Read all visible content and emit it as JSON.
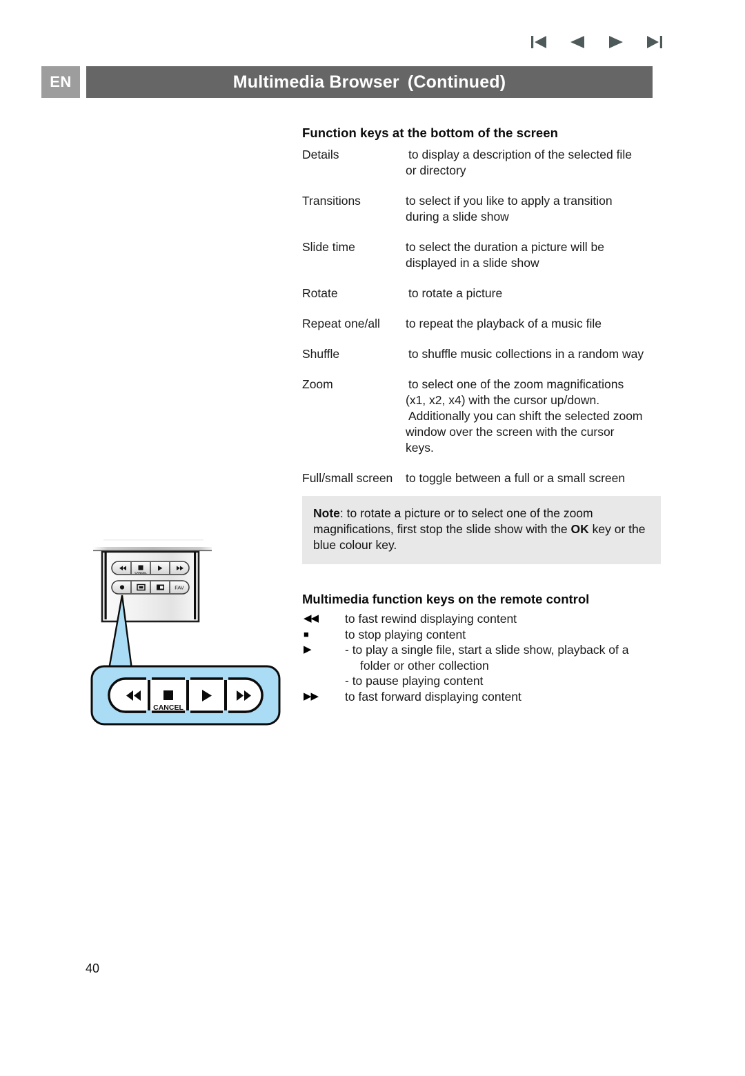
{
  "nav": {
    "icons": [
      {
        "name": "first-page-icon",
        "label": "first"
      },
      {
        "name": "previous-page-icon",
        "label": "previous"
      },
      {
        "name": "next-page-icon",
        "label": "next"
      },
      {
        "name": "last-page-icon",
        "label": "last"
      }
    ],
    "color": "#4e5a5a"
  },
  "header": {
    "language": "EN",
    "title": "Multimedia Browser",
    "title_suffix": "(Continued)",
    "bar_color": "#666666",
    "badge_color": "#9d9d9d"
  },
  "function_keys": {
    "heading": "Function keys at the bottom of the screen",
    "rows": [
      {
        "term": "Details",
        "lines": [
          "to display a description of the selected file",
          "or directory"
        ]
      },
      {
        "term": "Transitions",
        "lines": [
          "to select if you like to apply a transition",
          "during a slide show"
        ]
      },
      {
        "term": "Slide time",
        "lines": [
          "to select the duration a picture will be",
          "displayed in a slide show"
        ]
      },
      {
        "term": "Rotate",
        "lines": [
          "to rotate a picture"
        ]
      },
      {
        "term": "Repeat one/all",
        "lines": [
          "to repeat the playback of a music file"
        ]
      },
      {
        "term": "Shuffle",
        "lines": [
          "to shuffle music collections in a random way"
        ]
      },
      {
        "term": "Zoom",
        "lines": [
          "to select one of the zoom magnifications",
          "(x1, x2, x4) with the cursor up/down.",
          "Additionally you can shift the selected zoom",
          "window over the screen with the cursor",
          "keys."
        ]
      },
      {
        "term": "Full/small screen",
        "lines": [
          "to toggle between a full or a small screen"
        ]
      }
    ]
  },
  "note": {
    "label": "Note",
    "part1": ": to rotate a picture or to select one of the zoom magnifications, first stop the slide show with the ",
    "emphasis": "OK",
    "part2": " key or the blue colour key.",
    "background": "#e8e8e8"
  },
  "remote_keys": {
    "heading": "Multimedia function keys on the remote control",
    "rows": [
      {
        "glyph": "◀◀",
        "icon": "rewind-icon",
        "lines": [
          "to fast rewind displaying content"
        ]
      },
      {
        "glyph": "■",
        "icon": "stop-icon",
        "lines": [
          "to stop playing content"
        ]
      },
      {
        "glyph": "▶",
        "icon": "play-pause-icon",
        "lines": [
          "- to play a single file, start a slide show, playback of a",
          "folder or other collection",
          "- to pause playing content"
        ]
      },
      {
        "glyph": "▶▶",
        "icon": "fast-forward-icon",
        "lines": [
          "to fast forward displaying content"
        ]
      }
    ]
  },
  "remote_illustration": {
    "callout_color": "#aadcf5",
    "body_color": "#efefef",
    "top_row_buttons": [
      "rewind",
      "stop-cancel",
      "play",
      "fast-forward"
    ],
    "second_row_buttons": [
      "record",
      "subtitle",
      "pip",
      "FAV"
    ],
    "second_row_label": "FAV",
    "cancel_label_small": "CANCEL",
    "zoom_cancel_label": "CANCEL"
  },
  "page": {
    "number": "40"
  }
}
